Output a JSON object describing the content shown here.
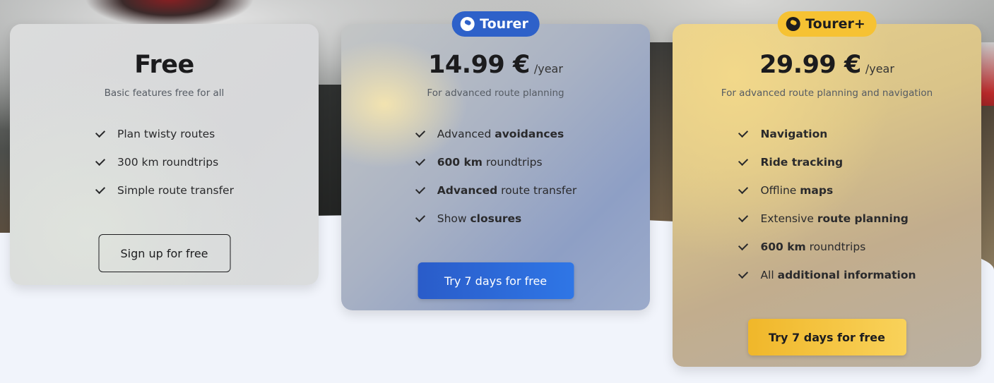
{
  "plans": {
    "free": {
      "title": "Free",
      "subtitle": "Basic features free for all",
      "features": [
        {
          "pre": "Plan twisty routes",
          "bold": "",
          "post": ""
        },
        {
          "pre": "300 km roundtrips",
          "bold": "",
          "post": ""
        },
        {
          "pre": "Simple route transfer",
          "bold": "",
          "post": ""
        }
      ],
      "cta": "Sign up for free"
    },
    "tourer": {
      "badge": "Tourer",
      "price": "14.99 €",
      "period": "/year",
      "subtitle": "For advanced route planning",
      "features": [
        {
          "pre": "Advanced ",
          "bold": "avoidances",
          "post": ""
        },
        {
          "pre": "",
          "bold": "600 km",
          "post": " roundtrips"
        },
        {
          "pre": "",
          "bold": "Advanced",
          "post": " route transfer"
        },
        {
          "pre": "Show ",
          "bold": "closures",
          "post": ""
        }
      ],
      "cta": "Try 7 days for free"
    },
    "tourer_plus": {
      "badge": "Tourer+",
      "price": "29.99 €",
      "period": "/year",
      "subtitle": "For advanced route planning and navigation",
      "features": [
        {
          "pre": "",
          "bold": "Navigation",
          "post": ""
        },
        {
          "pre": "",
          "bold": "Ride tracking",
          "post": ""
        },
        {
          "pre": "Offline ",
          "bold": "maps",
          "post": ""
        },
        {
          "pre": "Extensive ",
          "bold": "route planning",
          "post": ""
        },
        {
          "pre": "",
          "bold": "600 km",
          "post": " roundtrips"
        },
        {
          "pre": "All ",
          "bold": "additional information",
          "post": ""
        }
      ],
      "cta": "Try 7 days for free"
    }
  },
  "colors": {
    "tourer_accent": "#2e61c9",
    "plus_accent": "#f6c233",
    "page_background": "#f1f4fb"
  },
  "icons": {
    "feature": "check-icon",
    "badge": "kurviger-logo-icon"
  }
}
